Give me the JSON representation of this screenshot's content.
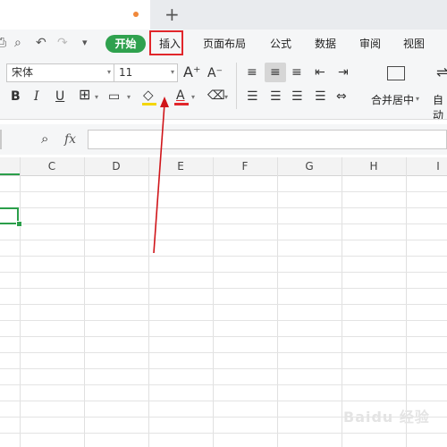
{
  "tabs": {
    "new_tab_label": "+"
  },
  "ribbon": {
    "start_button": "开始",
    "menu_tabs": [
      "插入",
      "页面布局",
      "公式",
      "数据",
      "审阅",
      "视图"
    ],
    "font_name": "宋体",
    "font_size": "11",
    "merge_label": "合并居中",
    "auto_label": "自动"
  },
  "formula_bar": {
    "fx_label": "fx"
  },
  "grid": {
    "columns": [
      "C",
      "D",
      "E",
      "F",
      "G",
      "H",
      "I"
    ]
  },
  "watermark": "Baidu 经验",
  "annotation": {
    "highlight_color": "#e1262b",
    "arrow_color": "#d0151a"
  },
  "colors": {
    "accent_green": "#2fa14e",
    "selection_green": "#2b9e4a"
  }
}
